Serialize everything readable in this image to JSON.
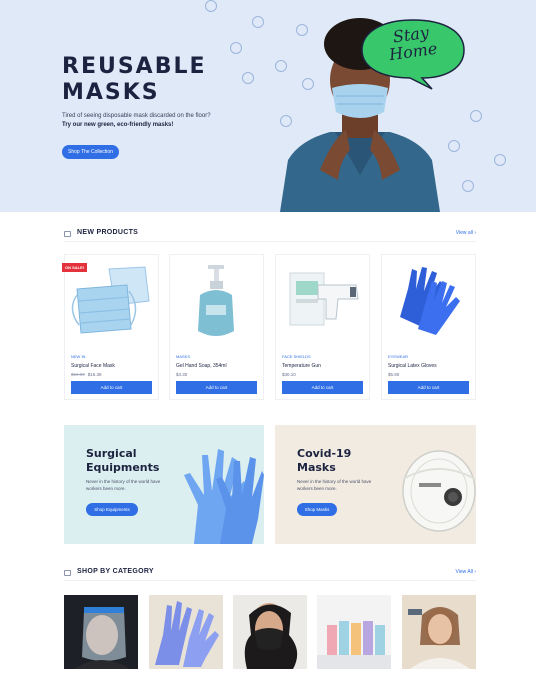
{
  "hero": {
    "title": "REUSABLE MASKS",
    "subtitle": "Tired of seeing disposable mask discarded on the floor?",
    "subtitle_bold": "Try our new green, eco-friendly masks!",
    "button_label": "Shop The Collection",
    "bubble_text": "Stay Home"
  },
  "new_products": {
    "title": "NEW PRODUCTS",
    "view_all": "View all  ›",
    "add_label": "Add to cart",
    "items": [
      {
        "badge": "ON SALE!",
        "category": "NEW IN",
        "name": "Surgical Face Mask",
        "old_price": "$19.00",
        "price": "$16.38"
      },
      {
        "badge": "",
        "category": "MASKS",
        "name": "Gel Hand Soap, 354ml",
        "old_price": "",
        "price": "$4.30"
      },
      {
        "badge": "",
        "category": "FACE SHIELDS",
        "name": "Temperature Gun",
        "old_price": "",
        "price": "$30.10"
      },
      {
        "badge": "",
        "category": "EYEWEAR",
        "name": "Surgical Latex Gloves",
        "old_price": "",
        "price": "$5.90"
      }
    ]
  },
  "promos": [
    {
      "title": "Surgical Equipments",
      "desc": "Never in the history of the world have workers been more.",
      "button": "Shop Equipments",
      "bg": "#dbeef0"
    },
    {
      "title": "Covid-19 Masks",
      "desc": "Never in the history of the world have workers been more.",
      "button": "Shop Masks",
      "bg": "#f2ebe1"
    }
  ],
  "categories": {
    "title": "SHOP BY CATEGORY",
    "view_all": "View All  ›",
    "items": [
      {
        "icon": "face-shield-photo"
      },
      {
        "icon": "gloves-photo"
      },
      {
        "icon": "mask-photo"
      },
      {
        "icon": "sanitizer-photo"
      },
      {
        "icon": "thermometer-photo"
      }
    ]
  },
  "colors": {
    "accent": "#2f6ee5",
    "sale": "#e3323b",
    "hero_bg": "#dfe9f8",
    "bubble": "#38c76a"
  }
}
